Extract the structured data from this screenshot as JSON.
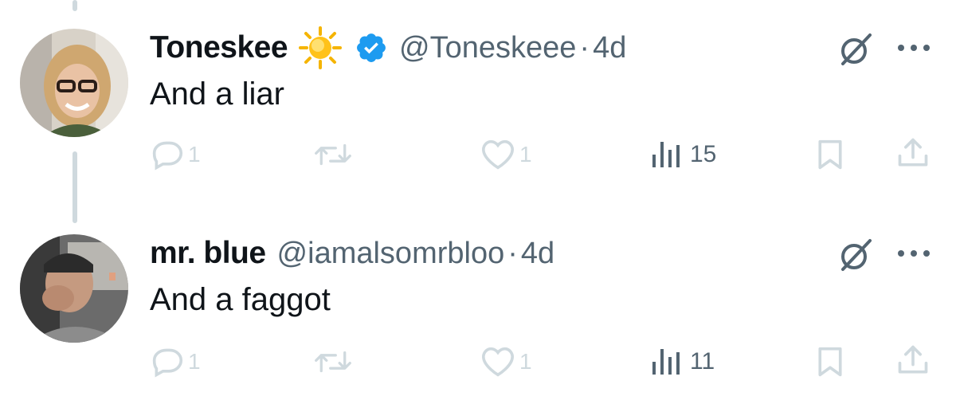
{
  "tweets": [
    {
      "display_name": "Toneskee",
      "handle": "@Toneskeee",
      "separator": "·",
      "time": "4d",
      "verified": true,
      "emoji": "sun",
      "text": "And a liar",
      "replies": "1",
      "likes": "1",
      "views": "15",
      "icons": [
        "grok-icon",
        "more-icon",
        "reply-icon",
        "retweet-icon",
        "like-icon",
        "views-icon",
        "bookmark-icon",
        "share-icon"
      ]
    },
    {
      "display_name": "mr. blue",
      "handle": "@iamalsomrbloo",
      "separator": "·",
      "time": "4d",
      "verified": false,
      "text": "And a faggot",
      "replies": "1",
      "likes": "1",
      "views": "11",
      "icons": [
        "grok-icon",
        "more-icon",
        "reply-icon",
        "retweet-icon",
        "like-icon",
        "views-icon",
        "bookmark-icon",
        "share-icon"
      ]
    }
  ],
  "colors": {
    "text_primary": "#0f1419",
    "text_secondary": "#536471",
    "icon_faint": "#cfd9de",
    "verified_blue": "#1d9bf0",
    "thread_line": "#cfd9de"
  }
}
